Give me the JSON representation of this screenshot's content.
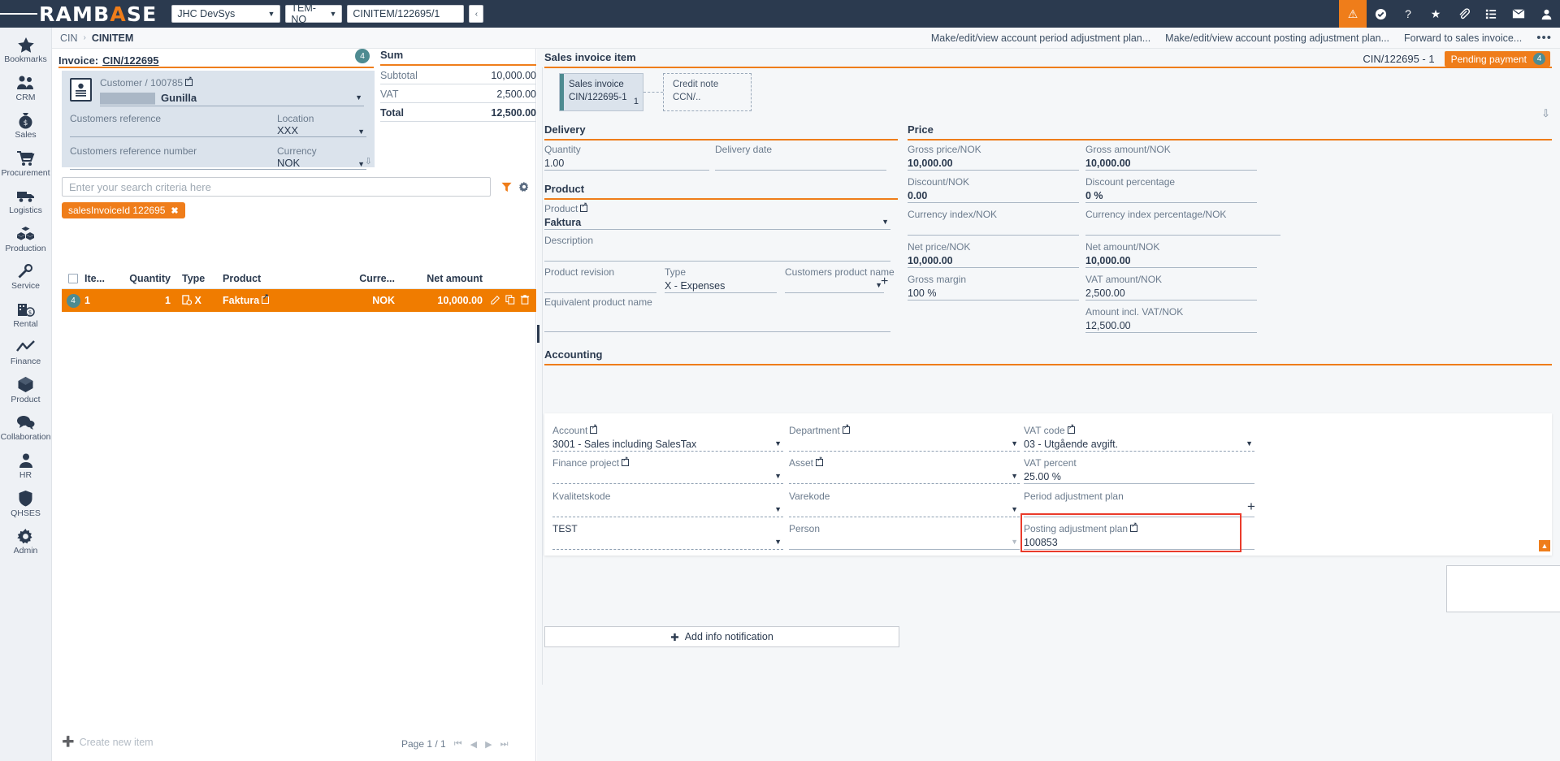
{
  "topbar": {
    "logo_main": "RAMB",
    "logo_accent_a": "A",
    "logo_tail": "SE",
    "logo_full": "RAMBASE",
    "company": "JHC DevSys",
    "unit": "TEM-NO",
    "document": "CINITEM/122695/1",
    "nav_prev": "‹",
    "icons": [
      {
        "name": "alert-icon",
        "glyph": "⚠"
      },
      {
        "name": "check-circle-icon",
        "glyph": "✔"
      },
      {
        "name": "help-icon",
        "glyph": "?"
      },
      {
        "name": "favorites-icon",
        "glyph": "★"
      },
      {
        "name": "attachment-icon",
        "glyph": "✎"
      },
      {
        "name": "list-icon",
        "glyph": "☰"
      },
      {
        "name": "mail-icon",
        "glyph": "✉"
      },
      {
        "name": "user-icon",
        "glyph": "὆4"
      }
    ]
  },
  "sidebar": {
    "items": [
      {
        "label": "Bookmarks",
        "icon": "star-icon"
      },
      {
        "label": "CRM",
        "icon": "people-icon"
      },
      {
        "label": "Sales",
        "icon": "money-bag-icon"
      },
      {
        "label": "Procurement",
        "icon": "shopping-cart-icon"
      },
      {
        "label": "Logistics",
        "icon": "truck-icon"
      },
      {
        "label": "Production",
        "icon": "boxes-icon"
      },
      {
        "label": "Service",
        "icon": "wrench-icon"
      },
      {
        "label": "Rental",
        "icon": "building-money-icon"
      },
      {
        "label": "Finance",
        "icon": "chart-line-icon"
      },
      {
        "label": "Product",
        "icon": "cube-icon"
      },
      {
        "label": "Collaboration",
        "icon": "chat-icon"
      },
      {
        "label": "HR",
        "icon": "person-icon"
      },
      {
        "label": "QHSES",
        "icon": "shield-icon"
      },
      {
        "label": "Admin",
        "icon": "gear-icon"
      }
    ]
  },
  "breadcrumb": {
    "parent": "CIN",
    "separator": "›",
    "current": "CINITEM",
    "actions": [
      "Make/edit/view account period adjustment plan...",
      "Make/edit/view account posting adjustment plan...",
      "Forward to sales invoice..."
    ],
    "more": "•••"
  },
  "left": {
    "invoice_label": "Invoice:",
    "invoice_link": "CIN/122695",
    "invoice_badge": "4",
    "customer": {
      "label": "Customer / 100785",
      "name_masked": "████████",
      "name": "Gunilla"
    },
    "fields": {
      "customers_reference_label": "Customers reference",
      "customers_reference_value": "",
      "location_label": "Location",
      "location_value": "XXX",
      "customers_reference_number_label": "Customers reference number",
      "customers_reference_number_value": "",
      "currency_label": "Currency",
      "currency_value": "NOK"
    },
    "sum": {
      "title": "Sum",
      "rows": [
        {
          "key": "Subtotal",
          "value": "10,000.00"
        },
        {
          "key": "VAT",
          "value": "2,500.00"
        },
        {
          "key": "Total",
          "value": "12,500.00"
        }
      ]
    },
    "search": {
      "placeholder": "Enter your search criteria here",
      "value": "",
      "filter_icon": "filter-icon",
      "gear_icon": "gear-icon",
      "chip_label": "salesInvoiceId 122695",
      "chip_close": "✖"
    },
    "table": {
      "columns": [
        "Ite...",
        "Quantity",
        "Type",
        "Product",
        "Curre...",
        "Net amount"
      ],
      "rows": [
        {
          "badge": "4",
          "item": "1",
          "quantity": "1",
          "type": "X",
          "product": "Faktura",
          "currency": "NOK",
          "net_amount": "10,000.00"
        }
      ]
    },
    "create_new": "Create new item",
    "pager": {
      "text": "Page 1 / 1",
      "first": "⏮",
      "prev": "◀",
      "next": "▶",
      "last": "⏭"
    }
  },
  "right": {
    "title": "Sales invoice item",
    "record_id": "CIN/122695 - 1",
    "status": "Pending payment",
    "status_count": "4",
    "flow": {
      "current": {
        "title": "Sales invoice",
        "id": "CIN/122695-1",
        "count": "1"
      },
      "next": {
        "title": "Credit note",
        "id": "CCN/.."
      }
    },
    "delivery": {
      "title": "Delivery",
      "quantity_label": "Quantity",
      "quantity_value": "1.00",
      "delivery_date_label": "Delivery date",
      "delivery_date_value": ""
    },
    "product": {
      "title": "Product",
      "product_label": "Product",
      "product_value": "Faktura",
      "description_label": "Description",
      "description_value": "",
      "product_revision_label": "Product revision",
      "product_revision_value": "",
      "type_label": "Type",
      "type_value": "X - Expenses",
      "customers_product_name_label": "Customers product name",
      "customers_product_name_value": "",
      "add_icon": "plus-icon",
      "equivalent_product_name_label": "Equivalent product name",
      "equivalent_product_name_value": ""
    },
    "price": {
      "title": "Price",
      "rows": [
        {
          "label": "Gross price/NOK",
          "value": "10,000.00"
        },
        {
          "label": "Gross amount/NOK",
          "value": "10,000.00"
        },
        {
          "label": "Discount/NOK",
          "value": "0.00"
        },
        {
          "label": "Discount percentage",
          "value": "0 %"
        },
        {
          "label": "Currency index/NOK",
          "value": ""
        },
        {
          "label": "Currency index percentage/NOK",
          "value": ""
        },
        {
          "label": "Net price/NOK",
          "value": "10,000.00"
        },
        {
          "label": "Net amount/NOK",
          "value": "10,000.00"
        },
        {
          "label": "Gross margin",
          "value": "100 %"
        },
        {
          "label": "VAT amount/NOK",
          "value": "2,500.00"
        },
        {
          "label": "Amount incl. VAT/NOK",
          "value": "12,500.00"
        }
      ]
    },
    "accounting": {
      "title": "Accounting",
      "account_label": "Account",
      "account_value": "3001 - Sales including SalesTax",
      "department_label": "Department",
      "department_value": "",
      "vat_code_label": "VAT code",
      "vat_code_value": "03 - Utgående avgift.",
      "finance_project_label": "Finance project",
      "finance_project_value": "",
      "asset_label": "Asset",
      "asset_value": "",
      "vat_percent_label": "VAT percent",
      "vat_percent_value": "25.00 %",
      "kvalitetskode_label": "Kvalitetskode",
      "kvalitetskode_value": "",
      "varekode_label": "Varekode",
      "varekode_value": "",
      "period_adjustment_plan_label": "Period adjustment plan",
      "period_adjustment_plan_value": "",
      "period_add_icon": "plus-icon",
      "test_label": "TEST",
      "test_value": "",
      "person_label": "Person",
      "person_value": "",
      "posting_adjustment_plan_label": "Posting adjustment plan",
      "posting_adjustment_plan_value": "100853"
    },
    "add_info_notification": "Add info notification",
    "note_value": "",
    "scroll_top": "▲"
  },
  "colors": {
    "brand_orange": "#ef7d1a",
    "navy": "#2b3a4f",
    "teal_badge": "#4e8b91",
    "highlight_red": "#ea3b2b",
    "panel_bg": "#f5f7f9",
    "card_blue": "#dbe3ec"
  }
}
